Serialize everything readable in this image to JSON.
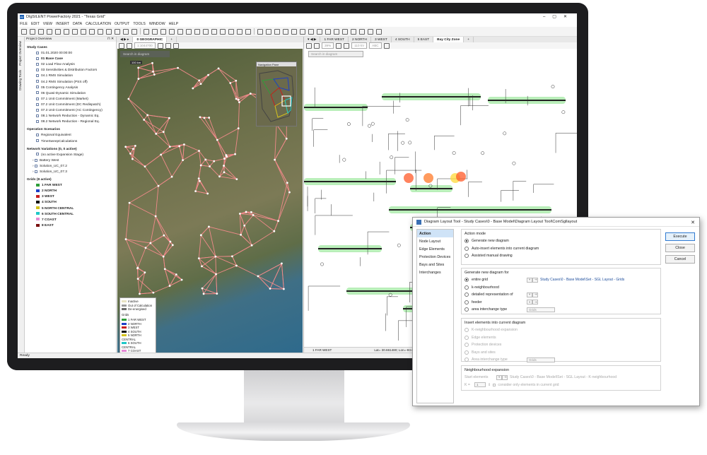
{
  "window": {
    "title": "DIgSILENT PowerFactory 2021 - \"Texas Grid\""
  },
  "menu": [
    "FILE",
    "EDIT",
    "VIEW",
    "INSERT",
    "DATA",
    "CALCULATION",
    "OUTPUT",
    "TOOLS",
    "WINDOW",
    "HELP"
  ],
  "side_tabs": [
    "Project Overview",
    "Drawing Tools"
  ],
  "project_overview": {
    "title": "Project Overview",
    "study_cases_label": "Study Cases",
    "study_cases": [
      "01.01.2020 00:00:00",
      "01 Base Case",
      "02 Load Flow Analysis",
      "03 Sensitivities & Distribution Factors",
      "04.1 RMS Simulation",
      "04.2 RMS Simulation (PSS off)",
      "05 Contingency Analysis",
      "06 Quasi-Dynamic Simulation",
      "07.1 Unit Commitment (Market)",
      "07.2 Unit Commitment (DC Redispatch)",
      "07.3 Unit Commitment (AC Contingency)",
      "08.1 Network Reduction - Dynamic Eq.",
      "08.2 Network Reduction - Regional Eq."
    ],
    "op_scenarios_label": "Operation Scenarios",
    "op_scenarios": [
      "Regional Equivalent",
      "TimeSweepCalculations"
    ],
    "variations_label": "Network Variations (0, 0 active)",
    "variations": [
      "(no active Expansion Stage)",
      "Battery West",
      "Solution_UC_07.2",
      "Solution_UC_07.3"
    ],
    "grids_label": "Grids (8 active)",
    "grids": [
      {
        "name": "1 FAR WEST",
        "color": "#2e9e3a"
      },
      {
        "name": "2 NORTH",
        "color": "#1e3fc8"
      },
      {
        "name": "3 WEST",
        "color": "#c81e1e"
      },
      {
        "name": "4 SOUTH",
        "color": "#111111"
      },
      {
        "name": "5 NORTH CENTRAL",
        "color": "#d4c21e"
      },
      {
        "name": "6 SOUTH CENTRAL",
        "color": "#1ec8c8"
      },
      {
        "name": "7 COAST",
        "color": "#e68ad6"
      },
      {
        "name": "8 EAST",
        "color": "#7a1010"
      }
    ]
  },
  "map_window": {
    "tabs": [
      "0 GEOGRAPHIC"
    ],
    "zoom": "1:1044700",
    "search_placeholder": "Search in diagram",
    "scale_label": "50 km",
    "scale_label2": "100 km",
    "navigation_pane": "Navigation Pane",
    "legend": {
      "states": [
        "Inactive",
        "Out of Calculation",
        "De-energised"
      ],
      "grids_title": "Grids",
      "grids": [
        "1 FAR WEST",
        "2 NORTH",
        "3 WEST",
        "4 SOUTH",
        "5 NORTH CENTRAL",
        "6 SOUTH CENTRAL",
        "7 COAST",
        "8 EAST"
      ]
    }
  },
  "sld_window": {
    "tabs": [
      "1 FAR WEST",
      "2 NORTH",
      "3 WEST",
      "4 SOUTH",
      "5 EAST",
      "Bay City Zone"
    ],
    "zoom": "39%",
    "voltage": "110 kV",
    "abc": "ABC",
    "search_placeholder": "Search in diagram",
    "status_grid": "1 FAR WEST",
    "status_coords": "Lat= 30.661480; Lon=-93.6"
  },
  "status_bar": {
    "text": "Ready"
  },
  "dialog": {
    "title": "Diagram Layout Tool - Study Cases\\0 - Base Model\\Diagram Layout Tool\\ComSgllayout",
    "nav": [
      "Action",
      "Node Layout",
      "Edge Elements",
      "Protection Devices",
      "Bays and Sites",
      "Interchanges"
    ],
    "action_mode": {
      "title": "Action mode",
      "options": [
        "Generate new diagram",
        "Auto-insert elements into current diagram",
        "Assisted manual drawing"
      ]
    },
    "generate": {
      "title": "Generate new diagram for",
      "options": [
        "entire grid",
        "k-neighbourhood",
        "detailed representation of",
        "feeder",
        "area interchange type"
      ],
      "link": "Study Cases\\0 - Base Model\\Set - SGL Layout - Grids",
      "area_dd": "Grids"
    },
    "insert": {
      "title": "Insert elements into current diagram",
      "options": [
        "K-neighbourhood expansion",
        "Edge elements",
        "Protection devices",
        "Bays and sites",
        "Area interchange type"
      ],
      "area_dd": "Grids"
    },
    "neighbourhood": {
      "title": "Neighbourhood expansion",
      "start_label": "Start elements",
      "start_value": "Study Cases\\0 - Base Model\\Set - SGL Layout - K-neighbourhood",
      "k_label": "K =",
      "k_value": "1",
      "checkbox": "consider only elements in current grid"
    },
    "buttons": {
      "execute": "Execute",
      "close": "Close",
      "cancel": "Cancel"
    }
  }
}
